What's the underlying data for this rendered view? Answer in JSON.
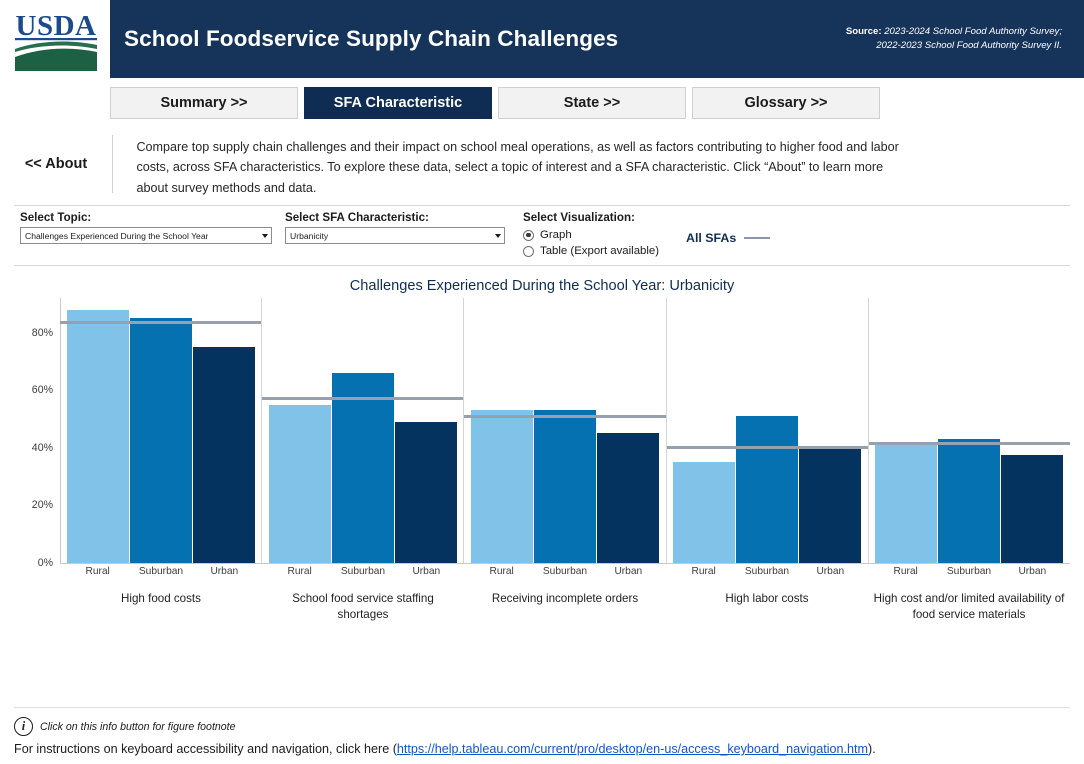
{
  "header": {
    "logo_alt": "USDA",
    "title": "School Foodservice Supply Chain Challenges",
    "source_label": "Source:",
    "source_line1": "2023-2024 School Food Authority Survey;",
    "source_line2": "2022-2023 School Food Authority Survey II.",
    "bar_color": "#163359"
  },
  "tabs": [
    {
      "label": "Summary >>",
      "active": false
    },
    {
      "label": "SFA Characteristic",
      "active": true
    },
    {
      "label": "State >>",
      "active": false
    },
    {
      "label": "Glossary >>",
      "active": false
    }
  ],
  "about": {
    "link_label": "<< About",
    "description": "Compare top supply chain challenges and their impact on school meal operations, as well as factors contributing to higher food and labor costs, across SFA characteristics. To explore these data, select a topic of interest and a SFA characteristic. Click “About” to learn more about survey methods and data."
  },
  "controls": {
    "topic": {
      "label": "Select Topic:",
      "value": "Challenges Experienced During the School Year"
    },
    "characteristic": {
      "label": "Select SFA Characteristic:",
      "value": "Urbanicity"
    },
    "visualization": {
      "label": "Select Visualization:",
      "options": [
        {
          "label": "Graph",
          "selected": true
        },
        {
          "label": "Table (Export available)",
          "selected": false
        }
      ]
    },
    "legend": {
      "label": "All SFAs",
      "line_color": "#97a0ae"
    }
  },
  "chart_data": {
    "type": "bar",
    "title": "Challenges Experienced During the School Year: Urbanicity",
    "xlabel": "",
    "ylabel": "",
    "ylim": [
      0,
      92
    ],
    "ytick_values": [
      0,
      20,
      40,
      60,
      80
    ],
    "ytick_labels": [
      "0%",
      "20%",
      "40%",
      "60%",
      "80%"
    ],
    "grid": false,
    "legend_position": "top-right",
    "series_names": [
      "Rural",
      "Suburban",
      "Urban"
    ],
    "series_colors": [
      "#81c3e8",
      "#0571b0",
      "#04335f"
    ],
    "reference_line_name": "All SFAs",
    "reference_line_color": "#97a0ae",
    "categories": [
      "High food costs",
      "School food service staffing shortages",
      "Receiving incomplete orders",
      "High labor costs",
      "High cost and/or limited availability of food service materials"
    ],
    "groups": [
      {
        "category": "High food costs",
        "bars": [
          {
            "name": "Rural",
            "value": 88
          },
          {
            "name": "Suburban",
            "value": 85
          },
          {
            "name": "Urban",
            "value": 75
          }
        ],
        "all_sfas": 83.5
      },
      {
        "category": "School food service staffing shortages",
        "bars": [
          {
            "name": "Rural",
            "value": 55
          },
          {
            "name": "Suburban",
            "value": 66
          },
          {
            "name": "Urban",
            "value": 49
          }
        ],
        "all_sfas": 57
      },
      {
        "category": "Receiving incomplete orders",
        "bars": [
          {
            "name": "Rural",
            "value": 53
          },
          {
            "name": "Suburban",
            "value": 53
          },
          {
            "name": "Urban",
            "value": 45
          }
        ],
        "all_sfas": 51
      },
      {
        "category": "High labor costs",
        "bars": [
          {
            "name": "Rural",
            "value": 35
          },
          {
            "name": "Suburban",
            "value": 51
          },
          {
            "name": "Urban",
            "value": 39.5
          }
        ],
        "all_sfas": 40
      },
      {
        "category": "High cost and/or limited availability of food service materials",
        "bars": [
          {
            "name": "Rural",
            "value": 42
          },
          {
            "name": "Suburban",
            "value": 43
          },
          {
            "name": "Urban",
            "value": 37.5
          }
        ],
        "all_sfas": 41.5
      }
    ]
  },
  "footer": {
    "info_glyph": "i",
    "info_text": "Click on this info button for figure footnote",
    "keyboard_text_before": "For instructions on keyboard accessibility and navigation,  click here (",
    "keyboard_link": "https://help.tableau.com/current/pro/desktop/en-us/access_keyboard_navigation.htm",
    "keyboard_text_after": ")."
  }
}
